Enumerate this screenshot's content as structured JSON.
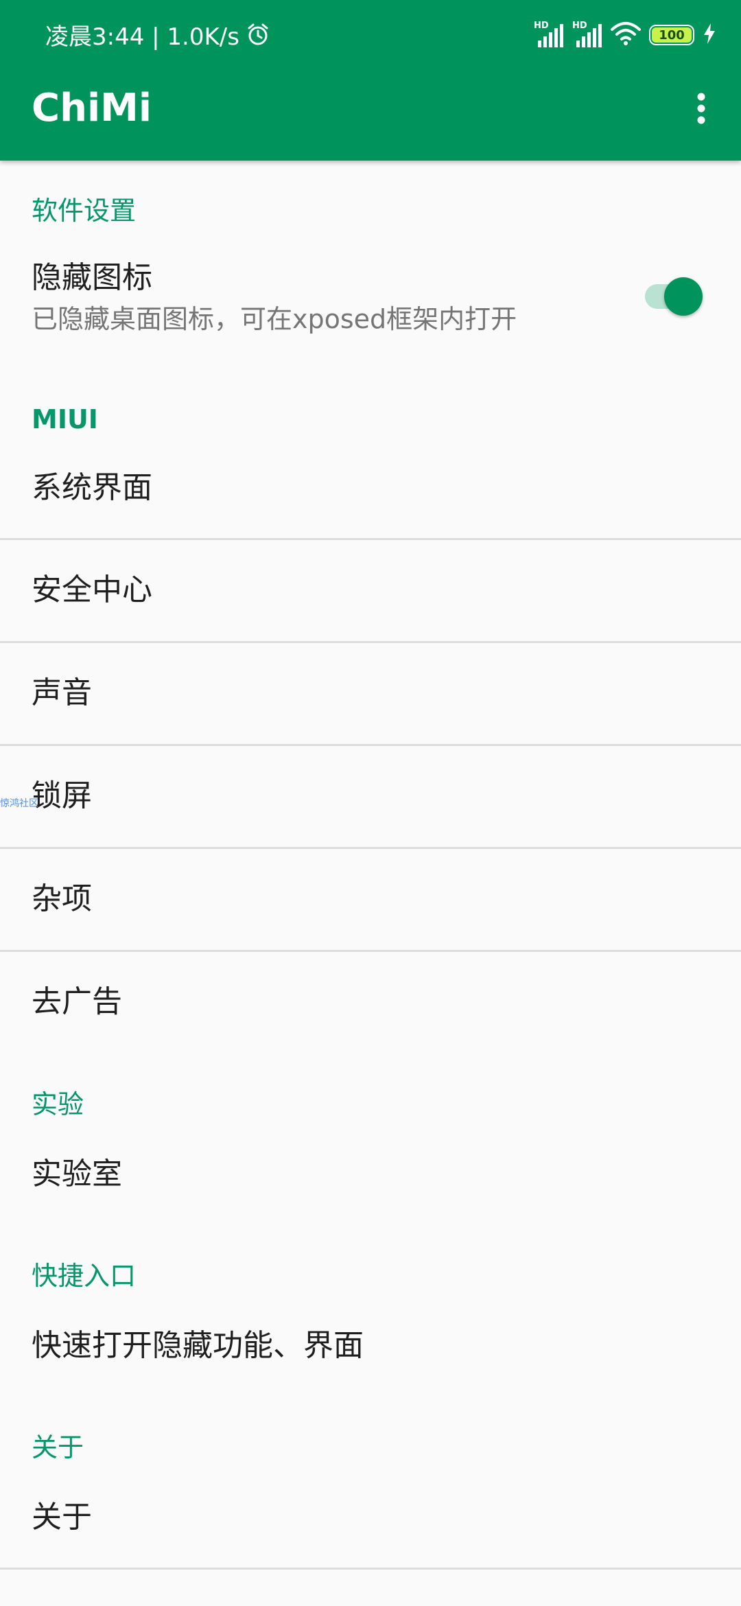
{
  "status_bar": {
    "time_speed": "凌晨3:44 | 1.0K/s",
    "signal_badge_1": "HD",
    "signal_badge_2": "HD",
    "battery_level": "100"
  },
  "appbar": {
    "title": "ChiMi"
  },
  "sections": {
    "software": {
      "header": "软件设置",
      "hide_icon": {
        "title": "隐藏图标",
        "summary": "已隐藏桌面图标，可在xposed框架内打开",
        "enabled": true
      }
    },
    "miui": {
      "header": "MIUI",
      "items": [
        "系统界面",
        "安全中心",
        "声音",
        "锁屏",
        "杂项",
        "去广告"
      ]
    },
    "experiment": {
      "header": "实验",
      "items": [
        "实验室"
      ]
    },
    "shortcut": {
      "header": "快捷入口",
      "items": [
        "快速打开隐藏功能、界面"
      ]
    },
    "about": {
      "header": "关于",
      "items": [
        "关于"
      ]
    }
  },
  "colors": {
    "primary": "#00945c",
    "accent_text": "#05966a",
    "background": "#fafafa"
  },
  "watermark": "惊鸿社区"
}
